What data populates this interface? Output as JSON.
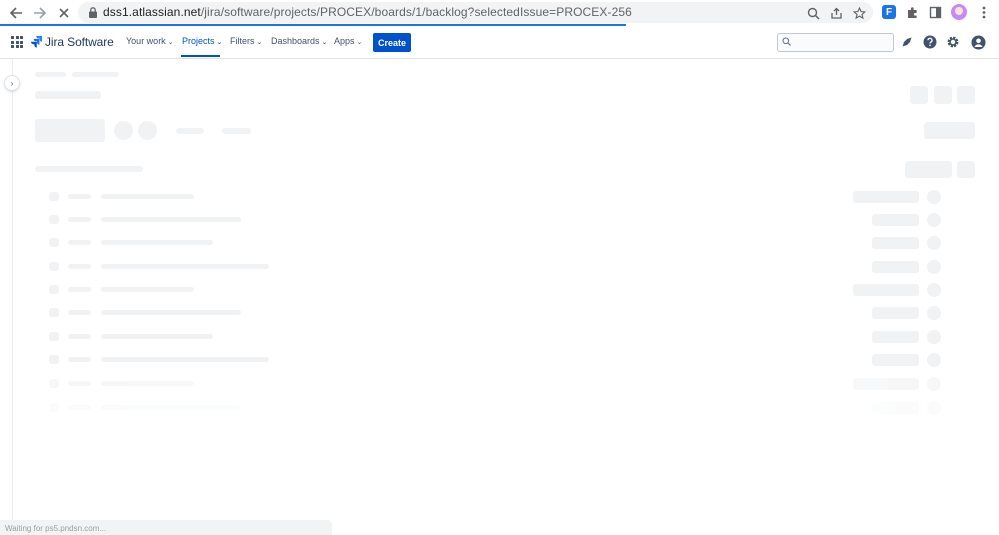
{
  "browser": {
    "url_host": "dss1.atlassian.net",
    "url_path": "/jira/software/projects/PROCEX/boards/1/backlog?selectedIssue=PROCEX-256",
    "status_text": "Waiting for ps5.pndsn.com..."
  },
  "jira": {
    "product_name": "Jira Software",
    "menu": {
      "your_work": "Your work",
      "projects": "Projects",
      "filters": "Filters",
      "dashboards": "Dashboards",
      "apps": "Apps"
    },
    "create_label": "Create",
    "search_placeholder": ""
  },
  "colors": {
    "brand": "#0052cc",
    "browser_accent": "#1a73e8",
    "skeleton": "#f1f2f4"
  },
  "icons": [
    "back-icon",
    "forward-icon",
    "stop-loading-icon",
    "lock-icon",
    "zoom-icon",
    "share-icon",
    "bookmark-star-icon",
    "extension-icon",
    "puzzle-icon",
    "side-panel-icon",
    "profile-avatar",
    "kebab-menu-icon",
    "app-switcher-icon",
    "notifications-icon",
    "help-icon",
    "settings-icon",
    "account-icon",
    "sidebar-expand-icon"
  ]
}
